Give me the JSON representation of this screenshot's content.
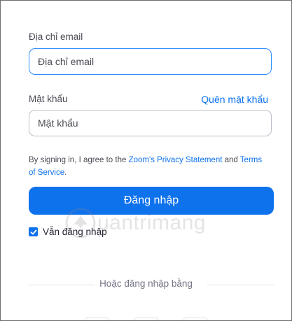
{
  "email": {
    "label": "Địa chỉ email",
    "placeholder": "Địa chỉ email"
  },
  "password": {
    "label": "Mật khẩu",
    "placeholder": "Mật khẩu",
    "forgot_link": "Quên mật khẩu"
  },
  "terms": {
    "prefix": "By signing in, I agree to the ",
    "privacy_link": "Zoom's Privacy Statement",
    "middle": " and ",
    "terms_link": "Terms of Service",
    "suffix": "."
  },
  "signin_button": "Đăng nhập",
  "stay_signed_in": {
    "label": "Vẫn đăng nhập",
    "checked": true
  },
  "divider_text": "Hoặc đăng nhập bằng",
  "watermark": {
    "text": "uantrimang"
  },
  "colors": {
    "accent": "#0e72ed",
    "focus_border": "#2d8cff"
  }
}
